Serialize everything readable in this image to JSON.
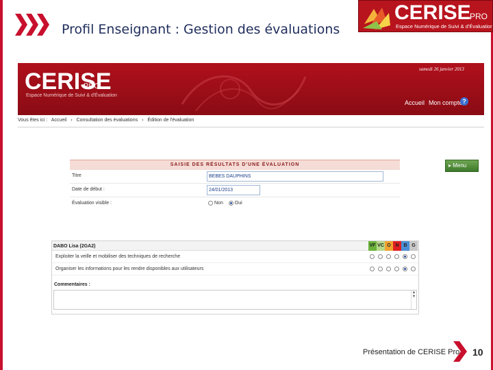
{
  "slide": {
    "title": "Profil Enseignant : Gestion des évaluations",
    "logo": {
      "main": "CERISE",
      "pro": "PRO",
      "subtitle": "Espace Numérique de Suivi & d'Évaluation"
    },
    "footer": "Présentation de CERISE Pro",
    "page_number": "10",
    "colors": {
      "accent": "#c8102e",
      "title": "#1f2d5c"
    }
  },
  "app": {
    "logo": {
      "main": "CERISE",
      "pro": "PRO",
      "subtitle": "Espace Numérique de Suivi & d'Évaluation"
    },
    "date": "samedi 26 janvier 2013",
    "nav": {
      "home": "Accueil",
      "account": "Mon compte",
      "help_icon": "?"
    },
    "breadcrumb": [
      "Vous êtes ici :",
      "Accueil",
      "›",
      "Consultation des évaluations",
      "›",
      "Édition de l'évaluation"
    ],
    "menu_button": "▸ Menu",
    "form": {
      "heading": "SAISIE DES RÉSULTATS D'UNE ÉVALUATION",
      "title_label": "Titre",
      "title_value": "BEBES DAUPHINS",
      "date_label": "Date de début :",
      "date_value": "24/01/2013",
      "visible_label": "Évaluation visible :",
      "visible_options": [
        "Non",
        "Oui"
      ],
      "visible_selected": "Oui"
    },
    "evaluation": {
      "student": "DABO Lisa (2GA2)",
      "columns": [
        "VF",
        "VC",
        "O",
        "N",
        "B",
        "G"
      ],
      "column_colors": [
        "#6bb33c",
        "#b6d88a",
        "#f0a330",
        "#e02020",
        "#4a8fd6",
        "#c8c8c8"
      ],
      "criteria": [
        {
          "label": "Exploiter la veille et mobiliser des techniques de recherche",
          "selected": "B"
        },
        {
          "label": "Organiser les informations pour les rendre disponibles aux utilisateurs",
          "selected": "B"
        }
      ],
      "comments_label": "Commentaires :"
    }
  }
}
